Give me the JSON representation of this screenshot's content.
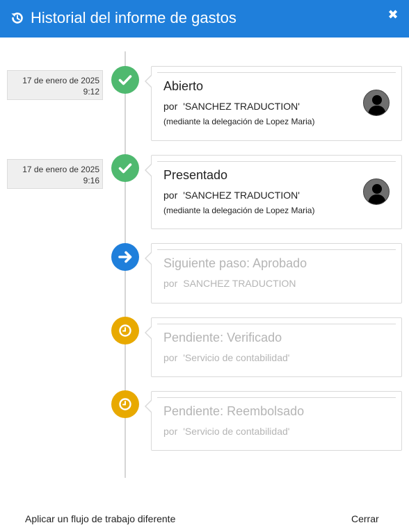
{
  "dialog": {
    "title": "Historial del informe de gastos",
    "close_glyph": "✖",
    "icon": "history-icon"
  },
  "timeline": [
    {
      "date": "17 de enero de 2025",
      "time": "9:12",
      "status": "done",
      "marker_icon": "check-icon",
      "title": "Abierto",
      "by_prefix": "por",
      "by": "'SANCHEZ TRADUCTION'",
      "note": "(mediante la delegación de Lopez Maria)",
      "has_avatar": true
    },
    {
      "date": "17 de enero de 2025",
      "time": "9:16",
      "status": "done",
      "marker_icon": "check-icon",
      "title": "Presentado",
      "by_prefix": "por",
      "by": "'SANCHEZ TRADUCTION'",
      "note": "(mediante la delegación de Lopez Maria)",
      "has_avatar": true
    },
    {
      "status": "next",
      "marker_icon": "arrow-right-icon",
      "title": "Siguiente paso: Aprobado",
      "by_prefix": "por",
      "by": "SANCHEZ TRADUCTION"
    },
    {
      "status": "pending",
      "marker_icon": "clock-icon",
      "title": "Pendiente: Verificado",
      "by_prefix": "por",
      "by": "'Servicio de contabilidad'"
    },
    {
      "status": "pending",
      "marker_icon": "clock-icon",
      "title": "Pendiente: Reembolsado",
      "by_prefix": "por",
      "by": "'Servicio de contabilidad'"
    }
  ],
  "footer": {
    "apply_workflow": "Aplicar un flujo de trabajo diferente",
    "close": "Cerrar"
  },
  "colors": {
    "header": "#1f7fdb",
    "done": "#4fb96f",
    "next": "#1f7fdb",
    "pending": "#e8a900"
  }
}
